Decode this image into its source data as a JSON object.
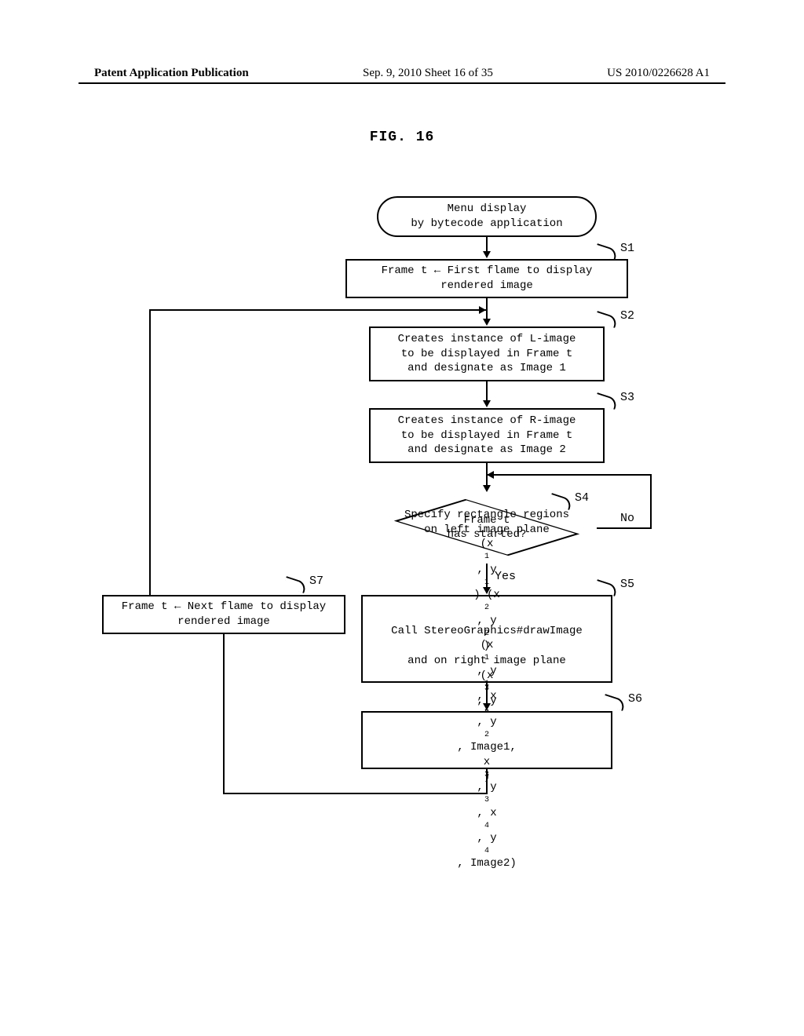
{
  "header": {
    "left": "Patent Application Publication",
    "center": "Sep. 9, 2010  Sheet 16 of 35",
    "right": "US 2010/0226628 A1"
  },
  "figure_title": "FIG. 16",
  "flow": {
    "start": "Menu display\nby bytecode application",
    "s1": {
      "label": "S1",
      "text": "Frame t ← First flame to display\nrendered image"
    },
    "s2": {
      "label": "S2",
      "text": "Creates instance of L-image\nto be displayed in Frame t\nand designate as Image 1"
    },
    "s3": {
      "label": "S3",
      "text": "Creates instance of R-image\nto be displayed in Frame t\nand designate as Image 2"
    },
    "s4": {
      "label": "S4",
      "text": "Frame t\nhas started?",
      "yes": "Yes",
      "no": "No"
    },
    "s5": {
      "label": "S5",
      "text_html": "Specify rectangle regions\non left image plane\n(x1, y1) (x2, y2)\nand on right image plane\n(x3, y3) (x4, y4)"
    },
    "s6": {
      "label": "S6",
      "text_html": "Call StereoGraphics#drawImage\n(x1, y1, x2, y2, Image1,\nx3, y3, x4, y4, Image2)"
    },
    "s7": {
      "label": "S7",
      "text": "Frame t ← Next flame to display\nrendered image"
    }
  },
  "chart_data": {
    "type": "flowchart",
    "nodes": [
      {
        "id": "start",
        "shape": "terminal",
        "text": "Menu display by bytecode application"
      },
      {
        "id": "S1",
        "shape": "process",
        "text": "Frame t ← First flame to display rendered image"
      },
      {
        "id": "S2",
        "shape": "process",
        "text": "Creates instance of L-image to be displayed in Frame t and designate as Image 1"
      },
      {
        "id": "S3",
        "shape": "process",
        "text": "Creates instance of R-image to be displayed in Frame t and designate as Image 2"
      },
      {
        "id": "S4",
        "shape": "decision",
        "text": "Frame t has started?"
      },
      {
        "id": "S5",
        "shape": "process",
        "text": "Specify rectangle regions on left image plane (x1, y1) (x2, y2) and on right image plane (x3, y3) (x4, y4)"
      },
      {
        "id": "S6",
        "shape": "process",
        "text": "Call StereoGraphics#drawImage (x1, y1, x2, y2, Image1, x3, y3, x4, y4, Image2)"
      },
      {
        "id": "S7",
        "shape": "process",
        "text": "Frame t ← Next flame to display rendered image"
      }
    ],
    "edges": [
      {
        "from": "start",
        "to": "S1"
      },
      {
        "from": "S1",
        "to": "S2"
      },
      {
        "from": "S2",
        "to": "S3"
      },
      {
        "from": "S3",
        "to": "S4"
      },
      {
        "from": "S4",
        "to": "S5",
        "label": "Yes"
      },
      {
        "from": "S4",
        "to": "S4",
        "label": "No",
        "loop": true
      },
      {
        "from": "S5",
        "to": "S6"
      },
      {
        "from": "S6",
        "to": "S7"
      },
      {
        "from": "S7",
        "to": "S2"
      }
    ]
  }
}
